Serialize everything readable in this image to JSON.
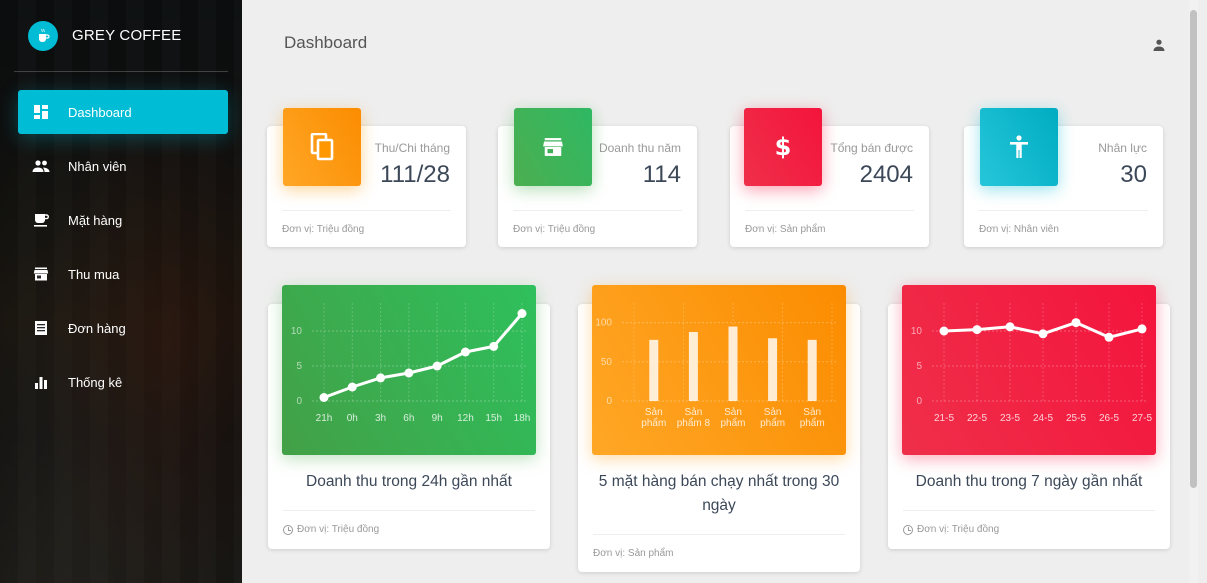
{
  "brand": {
    "name": "GREY COFFEE"
  },
  "sidebar": {
    "items": [
      {
        "label": "Dashboard",
        "icon": "dashboard-icon",
        "active": true
      },
      {
        "label": "Nhân viên",
        "icon": "people-icon"
      },
      {
        "label": "Mặt hàng",
        "icon": "cup-icon"
      },
      {
        "label": "Thu mua",
        "icon": "store-icon"
      },
      {
        "label": "Đơn hàng",
        "icon": "receipt-icon"
      },
      {
        "label": "Thống kê",
        "icon": "bar-chart-icon"
      }
    ]
  },
  "header": {
    "title": "Dashboard",
    "user_icon": "person-icon"
  },
  "stats": [
    {
      "label": "Thu/Chi tháng",
      "value": "111/28",
      "footer": "Đơn vị: Triệu đồng",
      "color": "#ff9800",
      "icon": "copy-icon"
    },
    {
      "label": "Doanh thu năm",
      "value": "114",
      "footer": "Đơn vị: Triệu đồng",
      "color": "#43a047",
      "icon": "store-icon"
    },
    {
      "label": "Tổng bán được",
      "value": "2404",
      "footer": "Đơn vị: Sản phẩm",
      "color": "#f4143c",
      "icon": "dollar-icon"
    },
    {
      "label": "Nhân lực",
      "value": "30",
      "footer": "Đơn vị: Nhân viên",
      "color": "#00bcd4",
      "icon": "accessibility-icon"
    }
  ],
  "charts": [
    {
      "title": "Doanh thu trong 24h gần nhất",
      "footer": "Đơn vị: Triệu đồng",
      "color": "#43a047",
      "footer_icon": "clock-icon"
    },
    {
      "title": "5 mặt hàng bán chạy nhất trong 30 ngày",
      "footer": "Đơn vị: Sản phẩm",
      "color": "#ff9800"
    },
    {
      "title": "Doanh thu trong 7 ngày gần nhất",
      "footer": "Đơn vị: Triệu đồng",
      "color": "#f4143c",
      "footer_icon": "clock-icon"
    }
  ],
  "chart_data": [
    {
      "type": "line",
      "categories": [
        "21h",
        "0h",
        "3h",
        "6h",
        "9h",
        "12h",
        "15h",
        "18h"
      ],
      "values": [
        0.5,
        2,
        3.3,
        4,
        5,
        7,
        7.8,
        12.5
      ],
      "yticks": [
        0,
        5,
        10
      ],
      "ylim": [
        0,
        14
      ]
    },
    {
      "type": "bar",
      "categories": [
        "Sản phẩm",
        "Sản phẩm 8",
        "Sản phẩm",
        "Sản phẩm",
        "Sản phẩm"
      ],
      "values": [
        78,
        88,
        95,
        80,
        78
      ],
      "yticks": [
        0,
        50,
        100
      ],
      "ylim": [
        0,
        125
      ]
    },
    {
      "type": "line",
      "categories": [
        "21-5",
        "22-5",
        "23-5",
        "24-5",
        "25-5",
        "26-5",
        "27-5"
      ],
      "values": [
        10,
        10.2,
        10.6,
        9.6,
        11.2,
        9.1,
        10.3
      ],
      "yticks": [
        0,
        5,
        10
      ],
      "ylim": [
        0,
        14
      ]
    }
  ]
}
